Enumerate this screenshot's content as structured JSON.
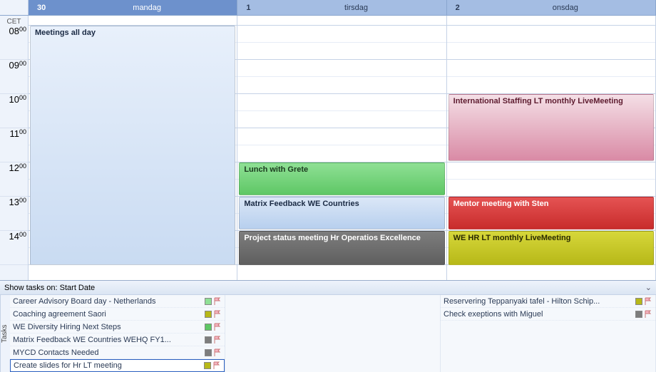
{
  "timezone_label": "CET",
  "days": [
    {
      "num": "30",
      "name": "mandag",
      "selected": true
    },
    {
      "num": "1",
      "name": "tirsdag",
      "selected": false
    },
    {
      "num": "2",
      "name": "onsdag",
      "selected": false
    }
  ],
  "hours": [
    "08",
    "09",
    "10",
    "11",
    "12",
    "13",
    "14"
  ],
  "minute_label": "00",
  "events": {
    "mon_allday": "Meetings all day",
    "tue_lunch": "Lunch with Grete",
    "tue_matrix": "Matrix Feedback WE Countries",
    "tue_project": "Project status meeting Hr Operatios Excellence",
    "wed_staffing": "International Staffing LT monthly LiveMeeting",
    "wed_mentor": "Mentor meeting with Sten",
    "wed_wehr": "WE HR LT monthly LiveMeeting"
  },
  "tasks_header": "Show tasks on: Start Date",
  "tasks_side_label": "Tasks",
  "tasks_col1": [
    {
      "label": "Career Advisory Board day - Netherlands",
      "cat": "cat-lgreen"
    },
    {
      "label": "Coaching agreement Saori",
      "cat": "cat-olive"
    },
    {
      "label": "WE Diversity Hiring Next Steps",
      "cat": "cat-green"
    },
    {
      "label": " Matrix  Feedback WE Countries  WEHQ FY1...",
      "cat": "cat-grey"
    },
    {
      "label": "MYCD Contacts Needed",
      "cat": "cat-grey"
    },
    {
      "label": "Create slides for Hr LT meeting",
      "cat": "cat-olive",
      "selected": true
    }
  ],
  "tasks_col3": [
    {
      "label": "Reservering Teppanyaki tafel - Hilton Schip...",
      "cat": "cat-olive"
    },
    {
      "label": "Check exeptions with Miguel",
      "cat": "cat-grey"
    }
  ]
}
